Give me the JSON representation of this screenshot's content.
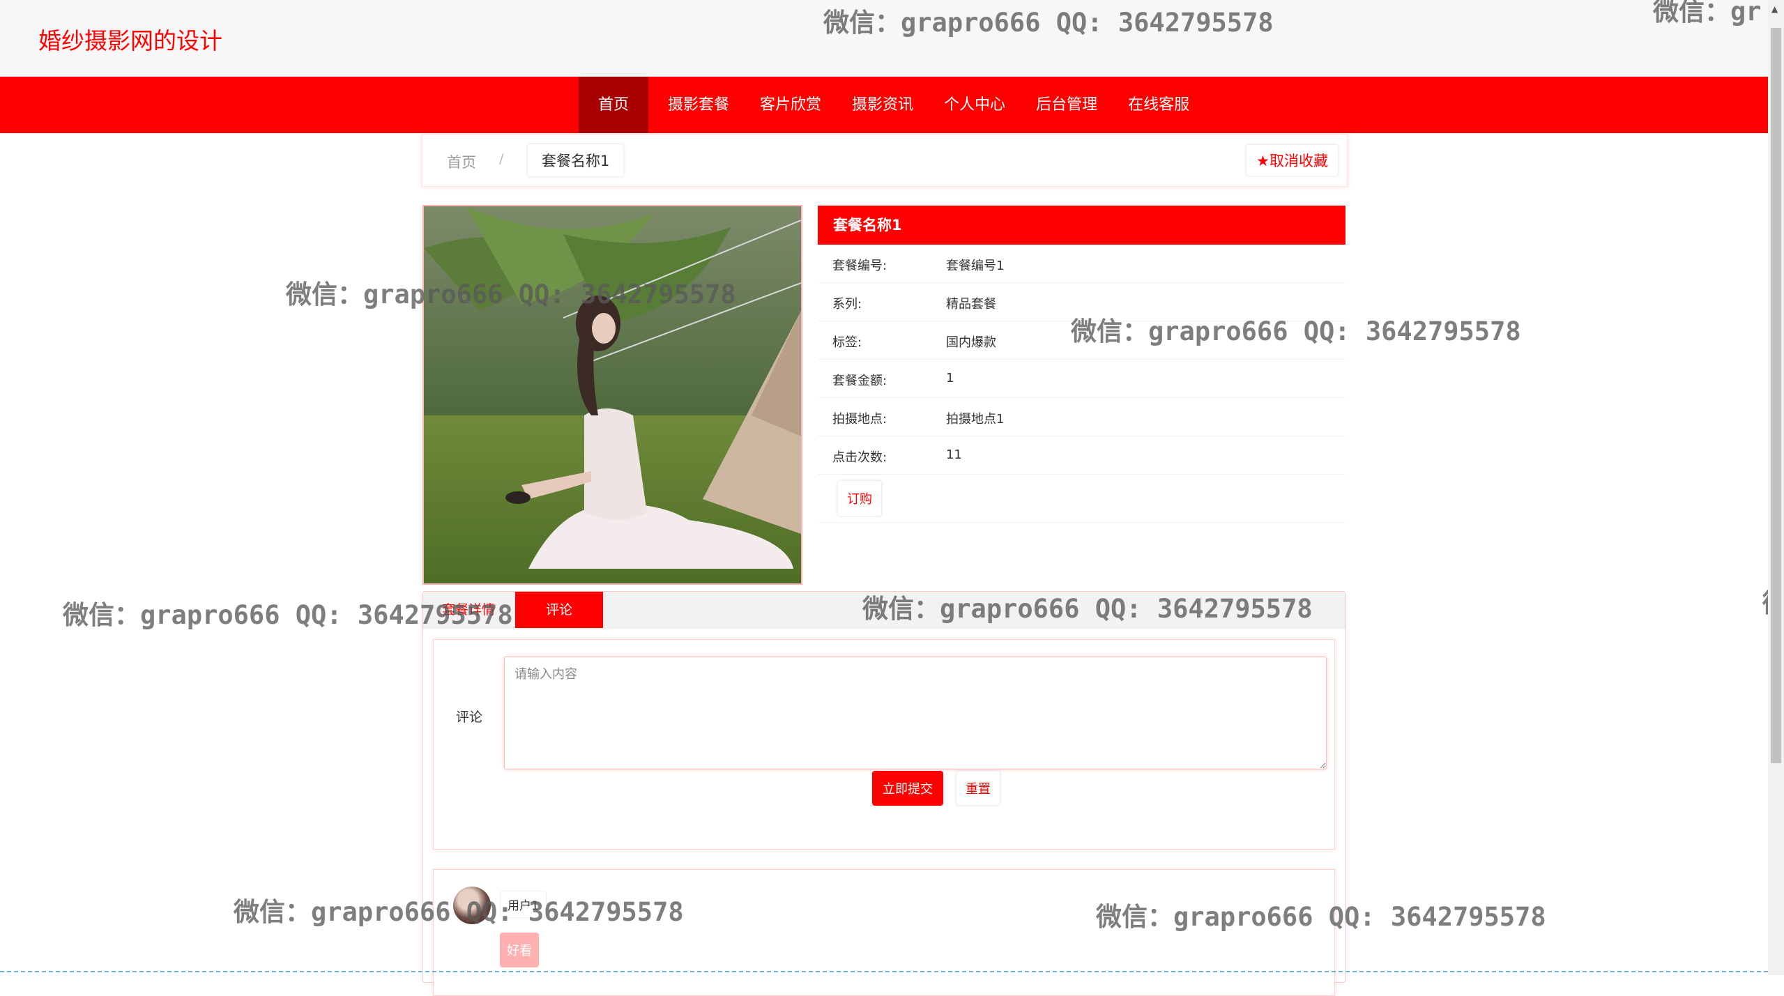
{
  "site": {
    "title": "婚纱摄影网的设计"
  },
  "nav": {
    "items": [
      "首页",
      "摄影套餐",
      "客片欣赏",
      "摄影资讯",
      "个人中心",
      "后台管理",
      "在线客服"
    ],
    "active": "首页"
  },
  "breadcrumb": {
    "home": "首页",
    "separator": "/",
    "current": "套餐名称1"
  },
  "favorite": {
    "icon": "star-icon",
    "label": "取消收藏"
  },
  "package": {
    "header": "套餐名称1",
    "fields": [
      {
        "label": "套餐编号:",
        "value": "套餐编号1"
      },
      {
        "label": "系列:",
        "value": "精品套餐"
      },
      {
        "label": "标签:",
        "value": "国内爆款"
      },
      {
        "label": "套餐金额:",
        "value": "1"
      },
      {
        "label": "拍摄地点:",
        "value": "拍摄地点1"
      },
      {
        "label": "点击次数:",
        "value": "11"
      }
    ],
    "order_button": "订购"
  },
  "tabs": {
    "detail": "套餐详情",
    "comment": "评论"
  },
  "comment_form": {
    "label": "评论",
    "placeholder": "请输入内容",
    "submit": "立即提交",
    "reset": "重置"
  },
  "comment": {
    "user": "用户1",
    "text": "好看"
  },
  "watermark": {
    "text": "微信：grapro666 QQ: 3642795578",
    "partial_right": "微信：gr",
    "partial_edge": "微"
  },
  "colors": {
    "primary": "#ff0000",
    "nav_active": "#a80000",
    "topbar": "#f7f7f7"
  }
}
